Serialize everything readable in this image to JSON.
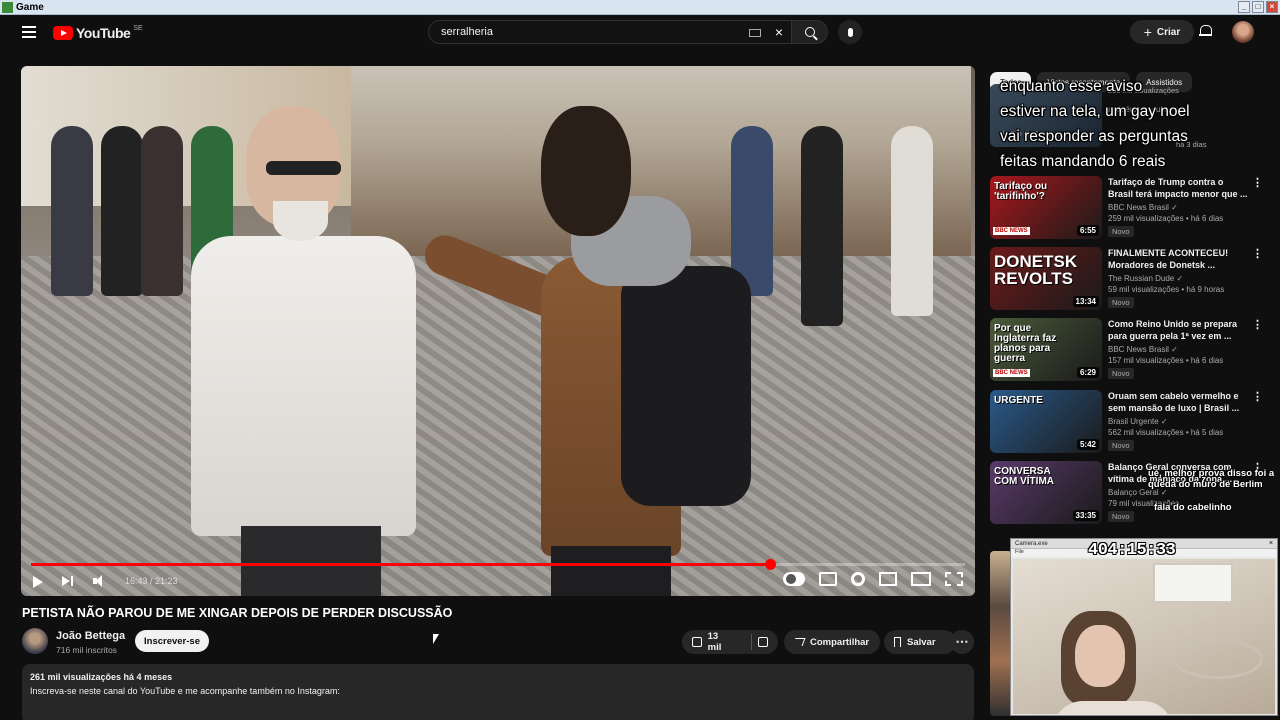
{
  "window": {
    "title": "Game"
  },
  "header": {
    "logo_text": "YouTube",
    "logo_country": "SE",
    "search_value": "serralheria",
    "create_label": "Criar"
  },
  "player": {
    "progress": 0.791,
    "time_text": "16:43 / 21:23"
  },
  "video": {
    "title": "PETISTA NÃO PAROU DE ME XINGAR DEPOIS DE PERDER DISCUSSÃO",
    "channel": "João Bettega",
    "subscribers": "716 mil inscritos",
    "subscribe_label": "Inscrever-se",
    "likes": "13 mil",
    "share_label": "Compartilhar",
    "save_label": "Salvar",
    "more_label": "⋯",
    "views_date": "261 mil visualizações  há 4 meses",
    "description": "Inscreva-se neste canal do YouTube e me acompanhe também no Instagram:"
  },
  "sidebar": {
    "chips": [
      "Todos",
      "Vistos recentemente",
      "Assistidos"
    ],
    "overlay_lines": [
      "enquanto esse aviso",
      "estiver na tela, um gay noel",
      "vai responder as perguntas",
      "feitas mandando 6 reais"
    ],
    "first_rec_fragments": [
      "antiaéreos ocultos nos",
      "do Rio de Janeiro",
      "280 mil visualizações",
      "há 3 dias"
    ],
    "recs": [
      {
        "title": "Tarifaço de Trump contra o Brasil terá impacto menor que ...",
        "channel": "BBC News Brasil ✓",
        "meta": "259 mil visualizações • há 6 dias",
        "badge": "Novo",
        "duration": "6:55",
        "thumb_text": "Tarifaço ou 'tarifinho'?",
        "thumb_color": "#a8181c"
      },
      {
        "title": "FINALMENTE ACONTECEU! Moradores de Donetsk ...",
        "channel": "The Russian Dude ✓",
        "meta": "59 mil visualizações • há 9 horas",
        "badge": "Novo",
        "duration": "13:34",
        "thumb_text": "DONETSK REVOLTS",
        "thumb_color": "#6b1a1a"
      },
      {
        "title": "Como Reino Unido se prepara para guerra pela 1ª vez em ...",
        "channel": "BBC News Brasil ✓",
        "meta": "157 mil visualizações • há 6 dias",
        "badge": "Novo",
        "duration": "6:29",
        "thumb_text": "Por que Inglaterra faz planos para guerra",
        "thumb_color": "#4a5a3a"
      },
      {
        "title": "Oruam sem cabelo vermelho e sem mansão de luxo | Brasil ...",
        "channel": "Brasil Urgente ✓",
        "meta": "562 mil visualizações • há 5 dias",
        "badge": "Novo",
        "duration": "5:42",
        "thumb_text": "URGENTE",
        "thumb_color": "#2a5a8a"
      },
      {
        "title": "Balanço Geral conversa com vítima de maníaco da zona ...",
        "channel": "Balanço Geral ✓",
        "meta": "79 mil visualizações",
        "badge": "Novo",
        "duration": "33:35",
        "thumb_text": "CONVERSA COM VÍTIMA",
        "thumb_color": "#5a3a6a"
      }
    ],
    "overlay_small": "ué, melhor prova disso foi a queda do muro de Berlim",
    "overlay_small3": "fala do cabelinho",
    "bbc_tag": "BBC NEWS"
  },
  "webcam": {
    "title": "Camera.exe",
    "menu": "File",
    "clock": "404:15:33"
  }
}
